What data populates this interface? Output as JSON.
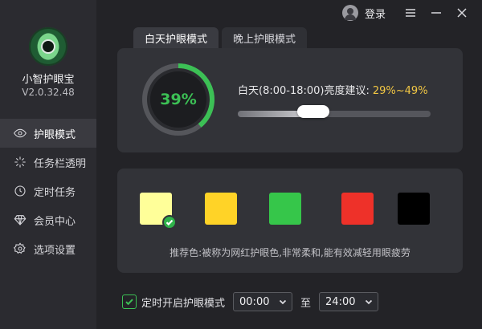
{
  "app": {
    "name": "小智护眼宝",
    "version": "V2.0.32.48"
  },
  "topbar": {
    "login_label": "登录"
  },
  "sidebar": {
    "items": [
      {
        "label": "护眼模式",
        "icon": "eye-icon",
        "active": true
      },
      {
        "label": "任务栏透明",
        "icon": "sparkle-icon",
        "active": false
      },
      {
        "label": "定时任务",
        "icon": "clock-icon",
        "active": false
      },
      {
        "label": "会员中心",
        "icon": "diamond-icon",
        "active": false
      },
      {
        "label": "选项设置",
        "icon": "gear-icon",
        "active": false
      }
    ]
  },
  "tabs": [
    {
      "label": "白天护眼模式",
      "active": true
    },
    {
      "label": "晚上护眼模式",
      "active": false
    }
  ],
  "brightness": {
    "percent_text": "39%",
    "percent": 39,
    "label": "白天(8:00-18:00)亮度建议:",
    "suggestion": "29%~49%"
  },
  "colors": {
    "swatches": [
      {
        "name": "pale-yellow",
        "hex": "#ffff99",
        "selected": true
      },
      {
        "name": "yellow",
        "hex": "#ffd327",
        "selected": false
      },
      {
        "name": "green",
        "hex": "#36c64a",
        "selected": false
      },
      {
        "name": "red",
        "hex": "#ee3129",
        "selected": false
      },
      {
        "name": "black",
        "hex": "#000000",
        "selected": false
      }
    ],
    "recommend_text": "推荐色:被称为网红护眼色,非常柔和,能有效减轻用眼疲劳"
  },
  "schedule": {
    "checkbox_label": "定时开启护眼模式",
    "checked": true,
    "start_time": "00:00",
    "to_label": "至",
    "end_time": "24:00"
  },
  "accent": {
    "green": "#3cc055",
    "yellow": "#f2c744"
  }
}
